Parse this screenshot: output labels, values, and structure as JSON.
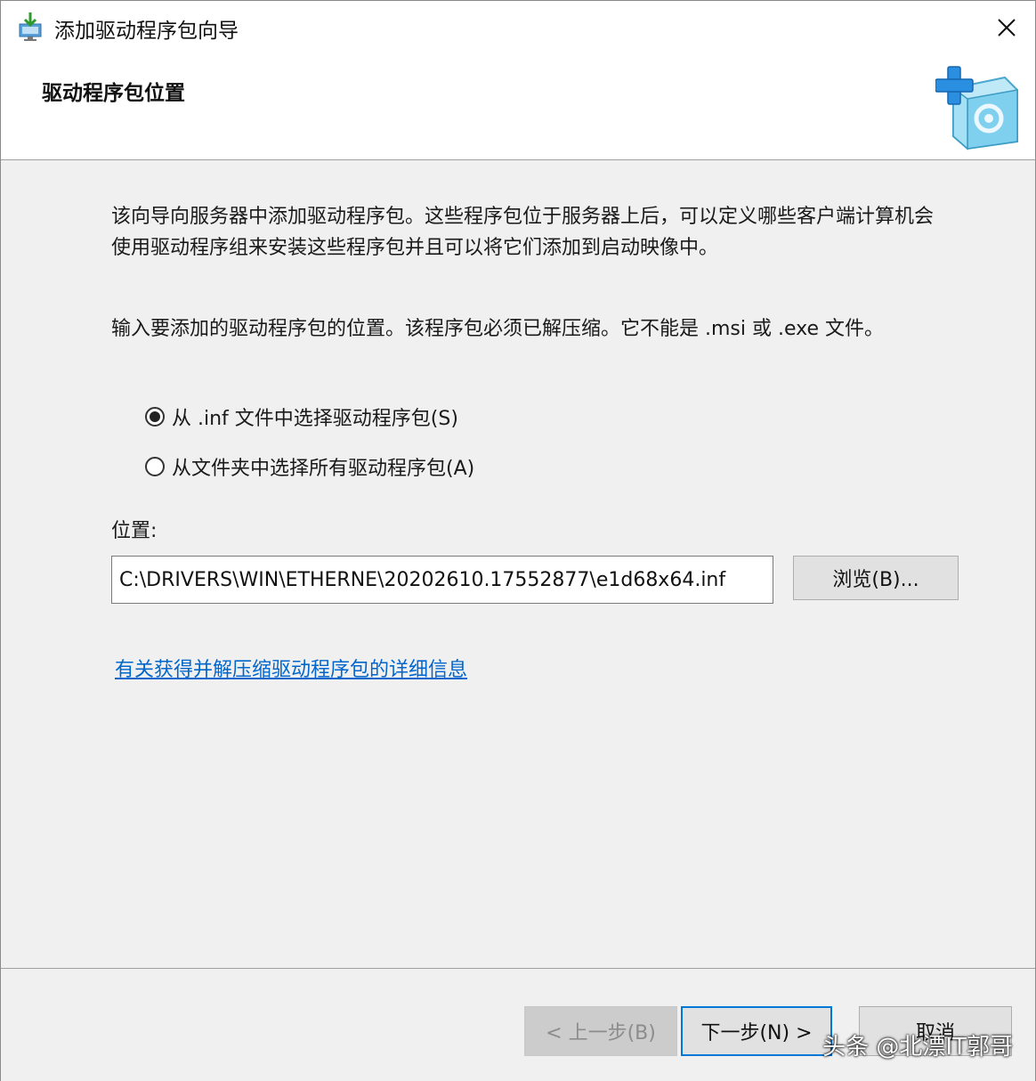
{
  "window": {
    "title": "添加驱动程序包向导",
    "title_icon": "wizard-install-icon",
    "close_icon": "close-icon"
  },
  "header": {
    "title": "驱动程序包位置",
    "graphic": "add-package-graphic-icon"
  },
  "content": {
    "intro": "该向导向服务器中添加驱动程序包。这些程序包位于服务器上后，可以定义哪些客户端计算机会使用驱动程序组来安装这些程序包并且可以将它们添加到启动映像中。",
    "instruction": "输入要添加的驱动程序包的位置。该程序包必须已解压缩。它不能是 .msi 或 .exe 文件。",
    "options": [
      {
        "label": "从 .inf 文件中选择驱动程序包(S)",
        "selected": true
      },
      {
        "label": "从文件夹中选择所有驱动程序包(A)",
        "selected": false
      }
    ],
    "location_label": "位置:",
    "location_value": "C:\\DRIVERS\\WIN\\ETHERNE\\20202610.17552877\\e1d68x64.inf",
    "browse_button": "浏览(B)...",
    "info_link": "有关获得并解压缩驱动程序包的详细信息"
  },
  "footer": {
    "back_button": "< 上一步(B)",
    "next_button": "下一步(N) >",
    "cancel_button": "取消"
  },
  "watermark": "头条 @北漂IT郭哥",
  "colors": {
    "link": "#0066cc",
    "focus_border": "#0078d7",
    "dialog_background": "#f0f0f0"
  }
}
